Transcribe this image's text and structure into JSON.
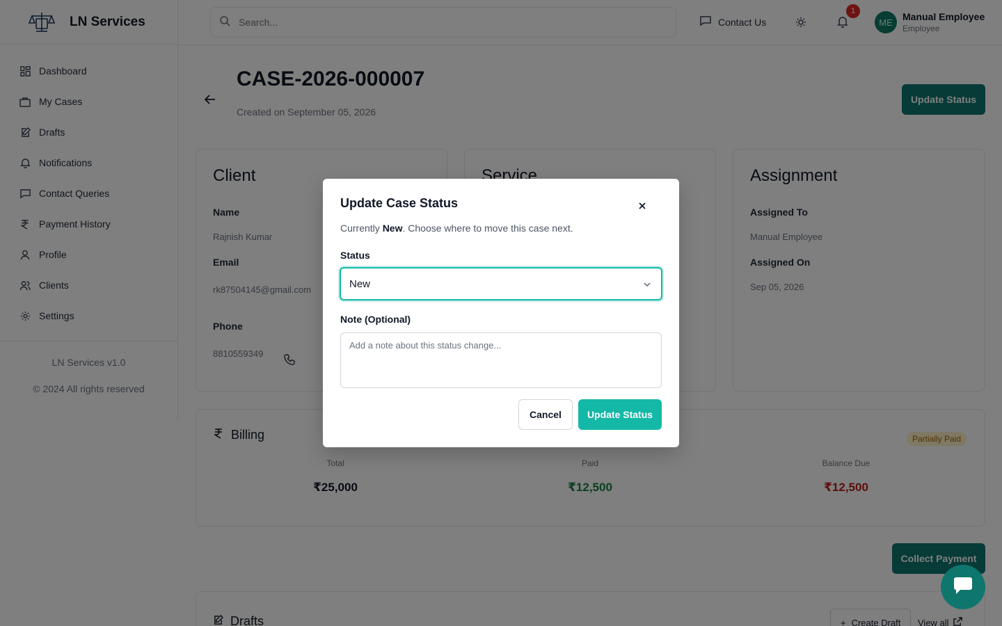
{
  "brand": {
    "name": "LN Services",
    "logo_icon": "scales-icon"
  },
  "sidebar": {
    "items": [
      {
        "label": "Dashboard",
        "icon": "grid-icon"
      },
      {
        "label": "My Cases",
        "icon": "briefcase-icon"
      },
      {
        "label": "Drafts",
        "icon": "edit-icon"
      },
      {
        "label": "Notifications",
        "icon": "bell-icon"
      },
      {
        "label": "Contact Queries",
        "icon": "message-icon"
      },
      {
        "label": "Payment History",
        "icon": "rupee-icon"
      },
      {
        "label": "Profile",
        "icon": "user-icon"
      },
      {
        "label": "Clients",
        "icon": "users-icon"
      },
      {
        "label": "Settings",
        "icon": "gear-icon"
      }
    ],
    "version": "LN Services v1.0",
    "copyright": "© 2024 All rights reserved"
  },
  "topbar": {
    "search_placeholder": "Search...",
    "contact_label": "Contact Us",
    "notification_count": "1",
    "avatar_initials": "ME",
    "user_name": "Manual Employee",
    "user_role": "Employee"
  },
  "case": {
    "id": "CASE-2026-000007",
    "created": "Created on September 05, 2026",
    "update_button": "Update Status"
  },
  "client_card": {
    "title": "Client",
    "name_label": "Name",
    "name_value": "Rajnish Kumar",
    "email_label": "Email",
    "email_value": "rk87504145@gmail.com",
    "phone_label": "Phone",
    "phone_value": "8810559349"
  },
  "service_card": {
    "title": "Service"
  },
  "assignment_card": {
    "title": "Assignment",
    "assigned_to_label": "Assigned To",
    "assigned_to_value": "Manual Employee",
    "assigned_on_label": "Assigned On",
    "assigned_on_value": "Sep 05, 2026"
  },
  "billing": {
    "title": "Billing",
    "status": "Partially Paid",
    "total_label": "Total",
    "total_value": "₹25,000",
    "paid_label": "Paid",
    "paid_value": "₹12,500",
    "balance_label": "Balance Due",
    "balance_value": "₹12,500",
    "collect_button": "Collect Payment",
    "colors": {
      "paid": "#15803d",
      "balance": "#b91c1c"
    }
  },
  "drafts": {
    "title": "Drafts",
    "create_button": "Create Draft",
    "view_all": "View all"
  },
  "modal": {
    "title": "Update Case Status",
    "desc_prefix": "Currently ",
    "current_status": "New",
    "desc_suffix": ". Choose where to move this case next.",
    "status_label": "Status",
    "status_value": "New",
    "note_label": "Note (Optional)",
    "note_placeholder": "Add a note about this status change...",
    "cancel_button": "Cancel",
    "update_button": "Update Status"
  },
  "accent_color": "#14b8a6"
}
